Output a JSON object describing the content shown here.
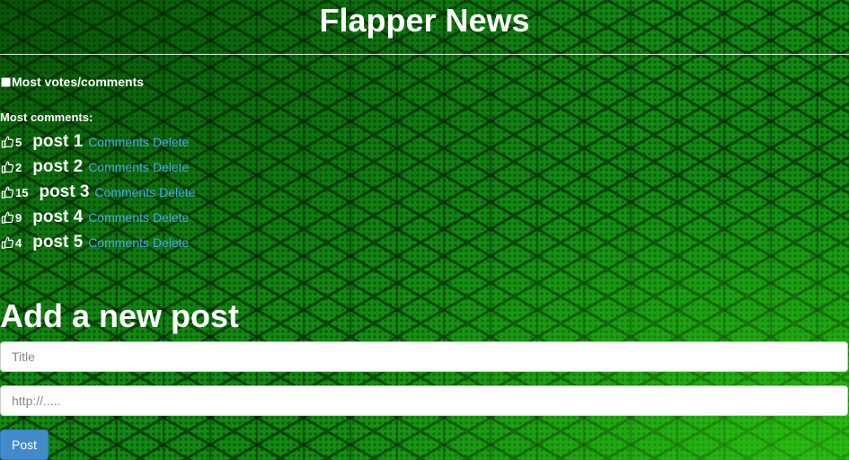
{
  "header": {
    "title": "Flapper News"
  },
  "sort_toggle": {
    "label": "Most votes/comments",
    "checked": false
  },
  "section": {
    "label": "Most comments:"
  },
  "posts": [
    {
      "votes": "5",
      "title": "post 1",
      "comments_label": "Comments",
      "delete_label": "Delete"
    },
    {
      "votes": "2",
      "title": "post 2",
      "comments_label": "Comments",
      "delete_label": "Delete"
    },
    {
      "votes": "15",
      "title": "post 3",
      "comments_label": "Comments",
      "delete_label": "Delete"
    },
    {
      "votes": "9",
      "title": "post 4",
      "comments_label": "Comments",
      "delete_label": "Delete"
    },
    {
      "votes": "4",
      "title": "post 5",
      "comments_label": "Comments",
      "delete_label": "Delete"
    }
  ],
  "form": {
    "heading": "Add a new post",
    "title_placeholder": "Title",
    "title_value": "",
    "link_placeholder": "http://.....",
    "link_value": "",
    "submit_label": "Post"
  },
  "colors": {
    "background": "#128a12",
    "link": "#4fa3e6",
    "button": "#428bca"
  },
  "icons": {
    "upvote": "thumbs-up-icon"
  }
}
